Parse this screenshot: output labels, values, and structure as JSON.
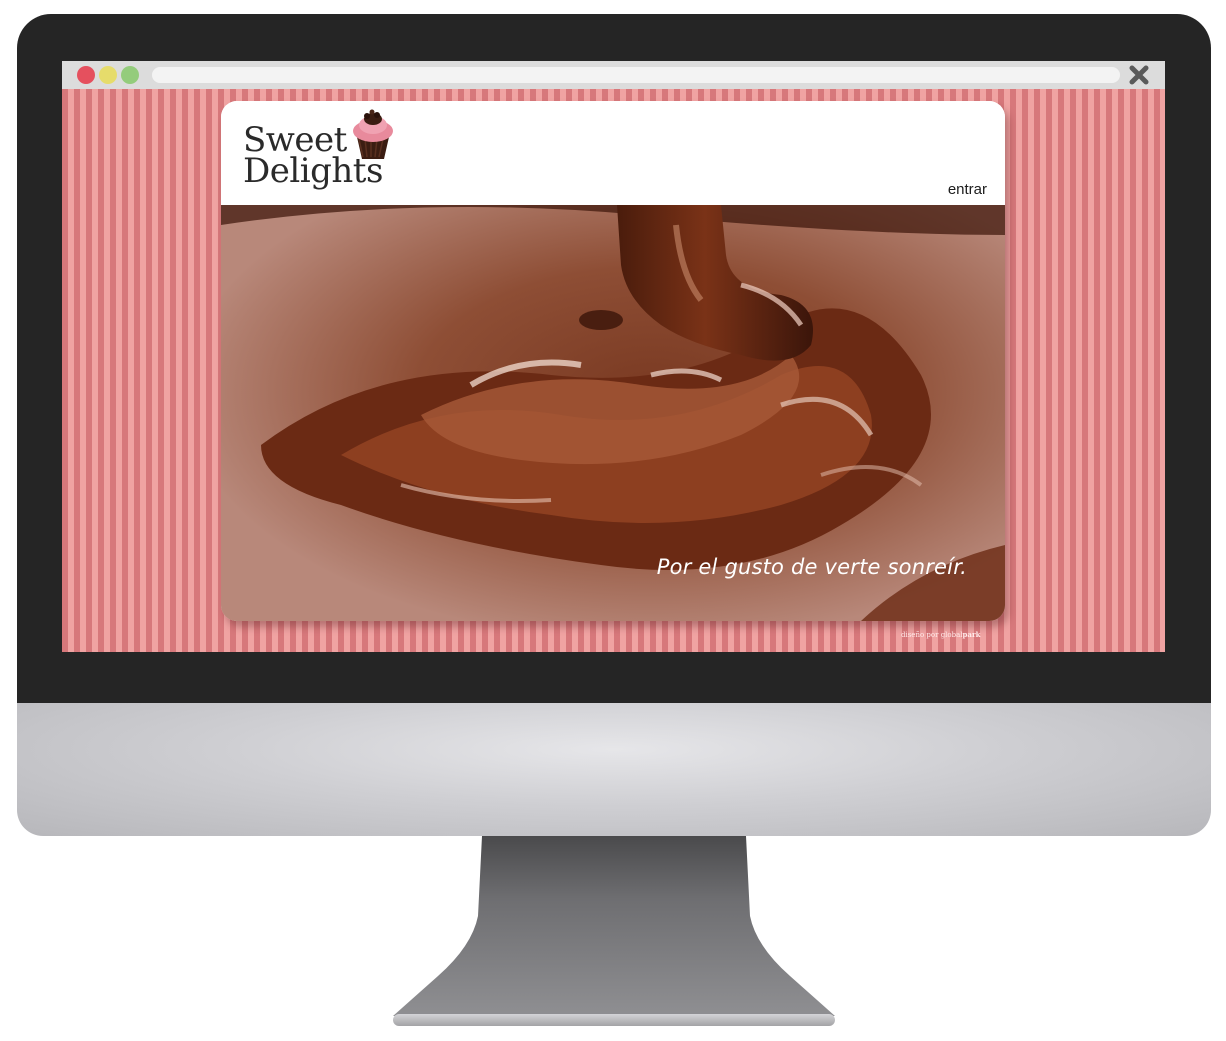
{
  "site": {
    "logo": {
      "line1": "Sweet",
      "line2": "Delights"
    },
    "nav": {
      "entrar_label": "entrar"
    },
    "hero": {
      "tagline": "Por el gusto de verte sonreír."
    },
    "credits": {
      "prefix": "diseño por",
      "brand_a": "global",
      "brand_b": "park"
    }
  },
  "browser": {
    "buttons": [
      "close",
      "minimize",
      "zoom"
    ],
    "close_icon": "close-icon"
  },
  "colors": {
    "stripe_dark": "#d7787b",
    "stripe_light": "#f0a3a2",
    "chocolate": "#5b2411",
    "bezel": "#252525"
  }
}
